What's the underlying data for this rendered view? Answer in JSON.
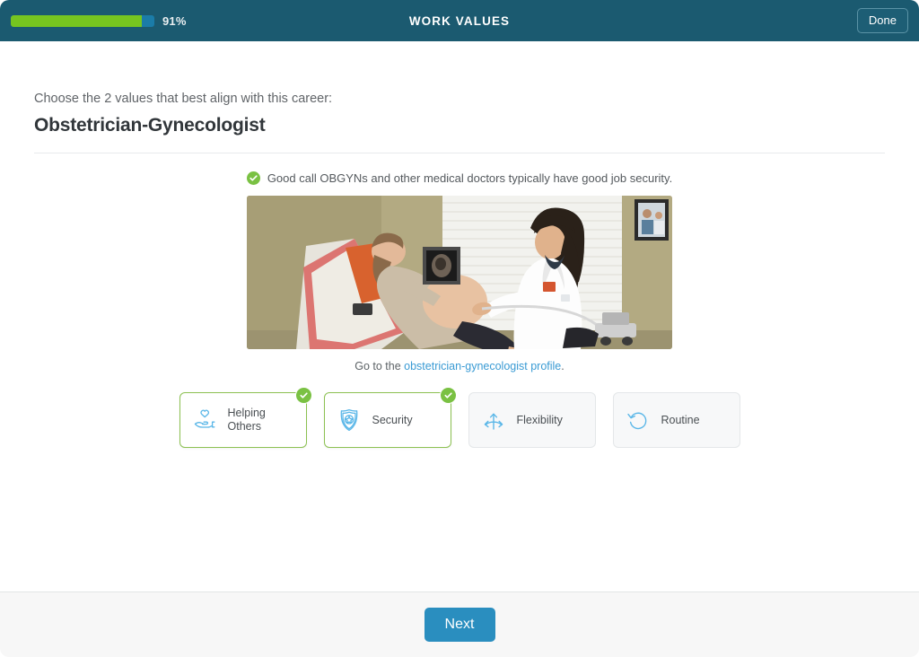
{
  "header": {
    "title": "WORK VALUES",
    "progress_percent": 91,
    "progress_label": "91%",
    "done_label": "Done",
    "bar_color": "#76c520",
    "bg_color": "#1b5a70"
  },
  "main": {
    "prompt": "Choose the 2 values that best align with this career:",
    "career_title": "Obstetrician-Gynecologist",
    "feedback": {
      "icon": "check-circle-icon",
      "text": "Good call OBGYNs and other medical doctors typically have good job security."
    },
    "photo": {
      "alt": "Doctor performing an ultrasound on a pregnant patient reclined in an exam chair"
    },
    "profile": {
      "prefix": "Go to the ",
      "link_text": "obstetrician-gynecologist profile",
      "suffix": ".",
      "link_color": "#3a9bd4"
    },
    "cards": [
      {
        "label": "Helping Others",
        "icon": "hand-heart-icon",
        "selected": true
      },
      {
        "label": "Security",
        "icon": "shield-badge-icon",
        "selected": true
      },
      {
        "label": "Flexibility",
        "icon": "branching-arrows-icon",
        "selected": false
      },
      {
        "label": "Routine",
        "icon": "circular-arrow-icon",
        "selected": false
      }
    ],
    "selected_color": "#8cc152",
    "icon_color": "#5bb7e8"
  },
  "footer": {
    "next_label": "Next",
    "next_color": "#2a8ebf"
  }
}
